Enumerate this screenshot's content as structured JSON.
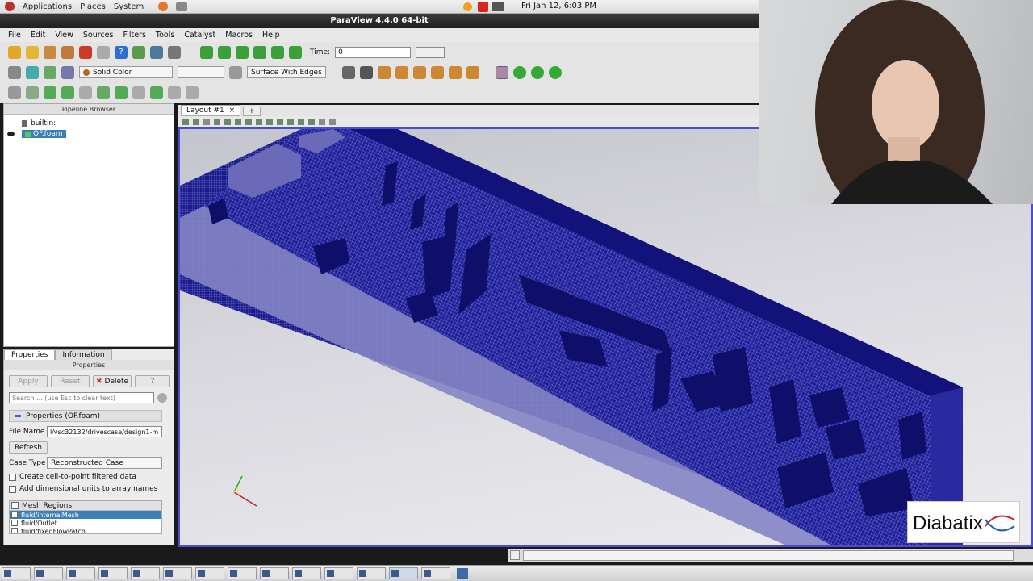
{
  "desktop": {
    "menus": [
      "Applications",
      "Places",
      "System"
    ],
    "clock": "Fri Jan 12,  6:03 PM"
  },
  "window": {
    "title": "ParaView 4.4.0 64-bit"
  },
  "menubar": [
    "File",
    "Edit",
    "View",
    "Sources",
    "Filters",
    "Tools",
    "Catalyst",
    "Macros",
    "Help"
  ],
  "toolbar": {
    "time_label": "Time:",
    "time_value": "0",
    "color_combo": "Solid Color",
    "representation_combo": "Surface With Edges"
  },
  "pipeline_browser": {
    "title": "Pipeline Browser",
    "root": "builtin:",
    "source": "OF.foam"
  },
  "properties_panel": {
    "tabs": [
      "Properties",
      "Information"
    ],
    "title": "Properties",
    "apply_label": "Apply",
    "reset_label": "Reset",
    "delete_label": "Delete",
    "help_label": "?",
    "search_placeholder": "Search ... (use Esc to clear text)",
    "section_label": "Properties (OF.foam)",
    "file_name_label": "File Name",
    "file_name_value": "l/vsc32132/drivescase/design1-m",
    "refresh_label": "Refresh",
    "case_type_label": "Case Type",
    "case_type_value": "Reconstructed Case",
    "option_1": "Create cell-to-point filtered data",
    "option_2": "Add dimensional units to array names",
    "mesh_regions_header": "Mesh Regions",
    "mesh_regions": [
      "fluid/internalMesh",
      "fluid/Outlet",
      "fluid/fixedFlowPatch"
    ]
  },
  "layout": {
    "tab_label": "Layout #1",
    "add_tab": "+"
  },
  "logo": {
    "text": "Diabatix"
  },
  "colors": {
    "mesh": "#1a1a8c",
    "viewport_border": "#4a4adb",
    "selection": "#3b7fb6"
  }
}
